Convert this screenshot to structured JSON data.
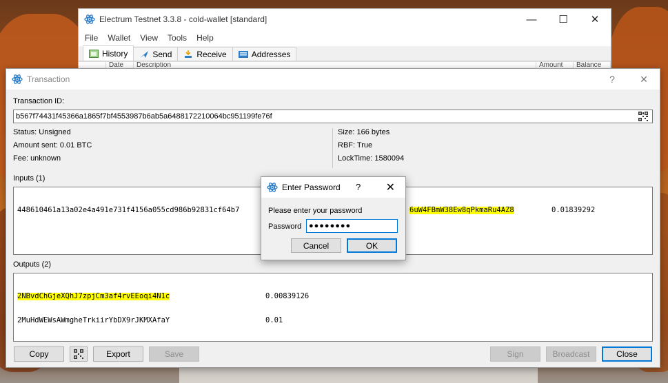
{
  "main_window": {
    "title": "Electrum Testnet 3.3.8  -  cold-wallet  [standard]",
    "controls": [
      "—",
      "☐",
      "✕"
    ],
    "menu": [
      "File",
      "Wallet",
      "View",
      "Tools",
      "Help"
    ],
    "tabs": [
      {
        "label": "History",
        "icon": "history-icon"
      },
      {
        "label": "Send",
        "icon": "send-icon"
      },
      {
        "label": "Receive",
        "icon": "receive-icon"
      },
      {
        "label": "Addresses",
        "icon": "addresses-icon"
      }
    ],
    "history_columns": [
      "Date",
      "Description",
      "Amount",
      "Balance"
    ]
  },
  "tx_dialog": {
    "title": "Transaction",
    "help": "?",
    "close": "✕",
    "txid_label": "Transaction ID:",
    "txid": "b567f74431f45366a1865f7bf4553987b6ab5a6488172210064bc951199fe76f",
    "status": "Status: Unsigned",
    "amount_sent": "Amount sent: 0.01 BTC",
    "fee": "Fee: unknown",
    "size": "Size: 166 bytes",
    "rbf": "RBF: True",
    "locktime": "LockTime: 1580094",
    "inputs_label": "Inputs (1)",
    "input": {
      "outpoint": "448610461a13a02e4a491e731f4156a055cd986b92831cf64b7",
      "address": "6uW4FBmW38Ew8qPkmaRu4AZ8",
      "amount": "0.01839292"
    },
    "outputs_label": "Outputs (2)",
    "outputs": [
      {
        "address": "2NBvdChGjeXQhJ7zpjCm3af4rvEEoqi4N1c",
        "amount": "0.00839126",
        "highlight": true
      },
      {
        "address": "2MuHdWEWsAWmgheTrkiirYbDX9rJKMXAfaY",
        "amount": "0.01",
        "highlight": false
      }
    ],
    "buttons": {
      "copy": "Copy",
      "export": "Export",
      "save": "Save",
      "sign": "Sign",
      "broadcast": "Broadcast",
      "close": "Close"
    }
  },
  "password_dialog": {
    "title": "Enter Password",
    "help": "?",
    "close": "✕",
    "prompt": "Please enter your password",
    "field_label": "Password",
    "value": "●●●●●●●●",
    "cancel": "Cancel",
    "ok": "OK"
  },
  "colors": {
    "highlight": "#ffff00",
    "focus_blue": "#0078d7",
    "electrum_blue": "#2d7ec8"
  }
}
